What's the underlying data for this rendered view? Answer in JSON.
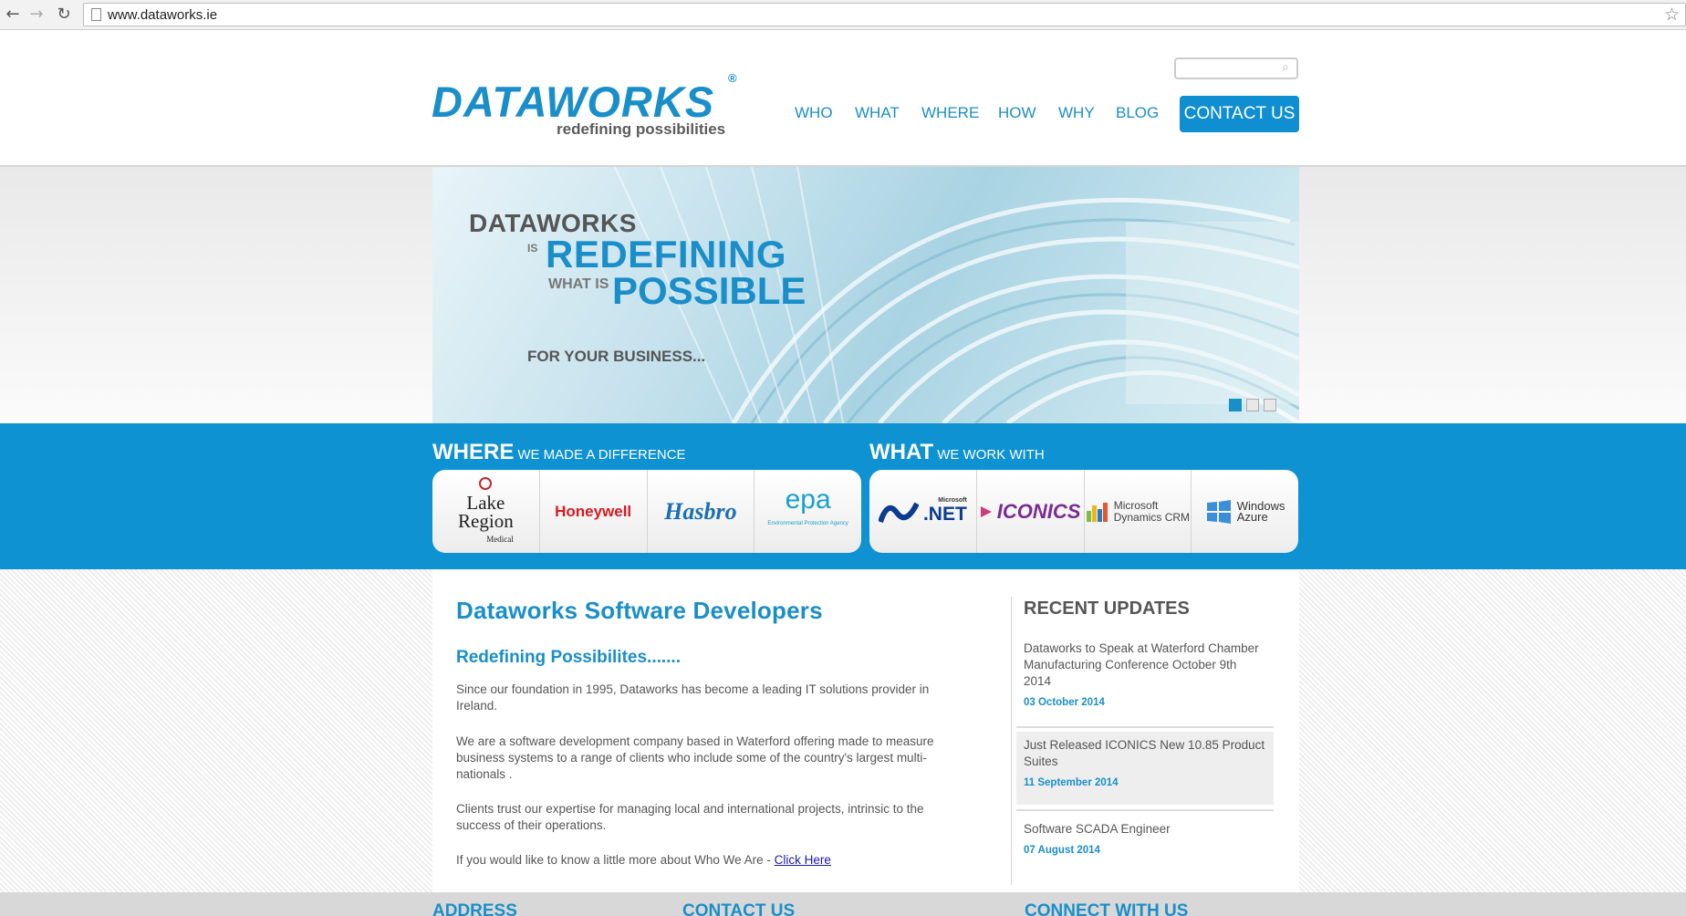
{
  "browser": {
    "url": "www.dataworks.ie",
    "back_icon": "←",
    "forward_icon": "→",
    "reload_icon": "↻",
    "star_icon": "☆"
  },
  "header": {
    "logo_text": "DATAWORKS",
    "logo_registered": "®",
    "logo_tagline": "redefining possibilities",
    "search_placeholder": "",
    "nav": [
      "WHO",
      "WHAT",
      "WHERE",
      "HOW",
      "WHY",
      "BLOG"
    ],
    "contact_label": "CONTACT US"
  },
  "hero": {
    "line1": "DATAWORKS",
    "is": "IS",
    "line2": "REDEFINING",
    "what_is": "WHAT IS",
    "line3": "POSSIBLE",
    "line4": "FOR YOUR BUSINESS...",
    "slide_count": 3,
    "active_slide": 1
  },
  "where": {
    "title_big": "WHERE",
    "title_small": "WE MADE A DIFFERENCE",
    "logos": {
      "lake_line1": "Lake",
      "lake_line2": "Region",
      "lake_sub": "Medical",
      "honeywell": "Honeywell",
      "hasbro": "Hasbro",
      "epa": "epa",
      "epa_sub": "Environmental Protection Agency"
    }
  },
  "what": {
    "title_big": "WHAT",
    "title_small": "WE WORK WITH",
    "logos": {
      "net_ms": "Microsoft",
      "net": ".NET",
      "iconics": "ICONICS",
      "crm_line1": "Microsoft",
      "crm_line2": "Dynamics CRM",
      "azure_line1": "Windows",
      "azure_line2": "Azure"
    }
  },
  "main": {
    "title": "Dataworks Software Developers",
    "subtitle": "Redefining Possibilites.......",
    "p1": "Since our foundation in 1995, Dataworks has become a leading IT solutions provider in Ireland.",
    "p2": "We are a software development company based in Waterford offering made to measure business systems to a range of clients who include some of the country's largest multi-nationals .",
    "p3": "Clients trust our expertise for managing local and international projects, intrinsic to the success of their operations.",
    "p4_text": "If you would like to know a little more about Who We Are  - ",
    "p4_link": "Click Here"
  },
  "updates": {
    "title": "RECENT UPDATES",
    "items": [
      {
        "text": "Dataworks to Speak at Waterford Chamber Manufacturing Conference October 9th 2014",
        "date": "03 October 2014"
      },
      {
        "text": "Just Released ICONICS New 10.85 Product Suites",
        "date": "11 September 2014"
      },
      {
        "text": "Software SCADA Engineer",
        "date": "07 August 2014"
      }
    ]
  },
  "footer": {
    "address": "ADDRESS",
    "contact": "CONTACT US",
    "connect": "CONNECT WITH US"
  },
  "colors": {
    "brand_blue": "#1a8ec9",
    "strip_blue": "#0e92d2",
    "honeywell_red": "#d71920"
  }
}
